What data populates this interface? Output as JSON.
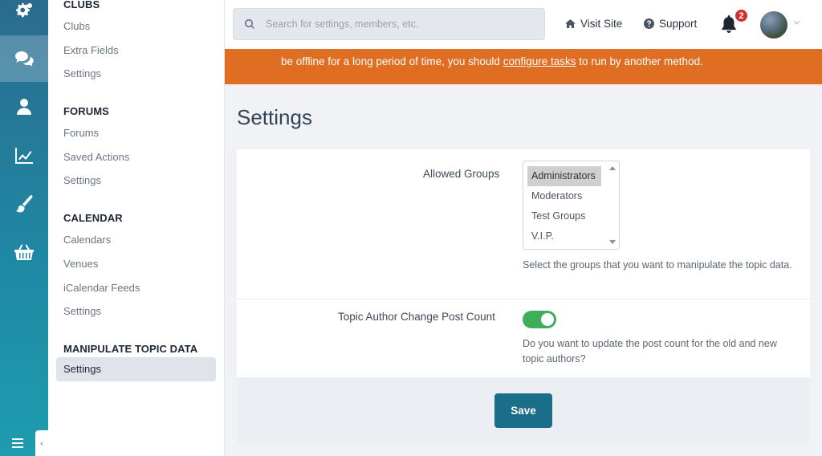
{
  "rail": {
    "items": [
      {
        "icon": "gears-icon"
      },
      {
        "icon": "comments-icon"
      },
      {
        "icon": "user-icon"
      },
      {
        "icon": "chart-line-icon"
      },
      {
        "icon": "paint-brush-icon"
      },
      {
        "icon": "shopping-basket-icon"
      }
    ],
    "menu_icon": "bars-icon",
    "collapse_glyph": "‹"
  },
  "subnav": {
    "clubs": {
      "heading": "CLUBS",
      "links": [
        "Clubs",
        "Extra Fields",
        "Settings"
      ]
    },
    "forums": {
      "heading": "FORUMS",
      "links": [
        "Forums",
        "Saved Actions",
        "Settings"
      ]
    },
    "calendar": {
      "heading": "CALENDAR",
      "links": [
        "Calendars",
        "Venues",
        "iCalendar Feeds",
        "Settings"
      ]
    },
    "manipulate": {
      "heading": "MANIPULATE TOPIC DATA",
      "links": [
        "Settings"
      ]
    }
  },
  "topbar": {
    "search_placeholder": "Search for settings, members, etc.",
    "visit_site": "Visit Site",
    "support": "Support",
    "notification_count": "2"
  },
  "banner": {
    "text_before": "be offline for a long period of time, you should ",
    "link": "configure tasks",
    "text_after": " to run by another method.",
    "color": "#e06e22"
  },
  "page": {
    "title": "Settings",
    "allowed_groups_label": "Allowed Groups",
    "groups": [
      "Administrators",
      "Moderators",
      "Test Groups",
      "V.I.P."
    ],
    "selected_group": "Administrators",
    "groups_help": "Select the groups that you want to manipulate the topic data.",
    "post_count_label": "Topic Author Change Post Count",
    "post_count_enabled": true,
    "post_count_help": "Do you want to update the post count for the old and new topic authors?",
    "save_label": "Save"
  },
  "colors": {
    "accent": "#1a6e89",
    "toggle_on": "#3fae5b",
    "badge": "#d0312d"
  }
}
